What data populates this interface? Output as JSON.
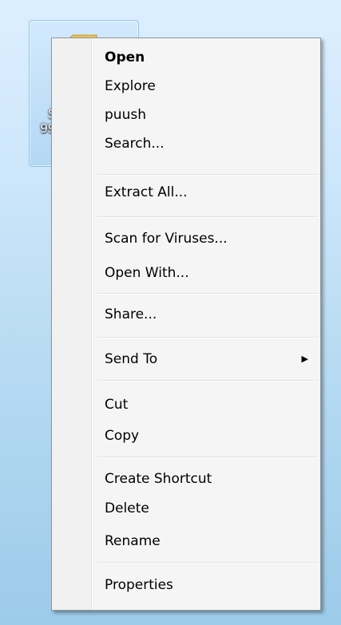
{
  "desktop_icon": {
    "label_lines": [
      "Se",
      "990",
      "("
    ],
    "icon": "folder-icon"
  },
  "context_menu": {
    "items": [
      {
        "label": "Open",
        "default": true
      },
      {
        "label": "Explore"
      },
      {
        "label": "puush"
      },
      {
        "label": "Search..."
      },
      {
        "label": "Extract All..."
      },
      {
        "label": "Scan for Viruses..."
      },
      {
        "label": "Open With..."
      },
      {
        "label": "Share..."
      },
      {
        "label": "Send To",
        "submenu": true,
        "submenu_icon": "chevron-right-icon",
        "arrow_glyph": "▶"
      },
      {
        "label": "Cut"
      },
      {
        "label": "Copy"
      },
      {
        "label": "Create Shortcut"
      },
      {
        "label": "Delete"
      },
      {
        "label": "Rename"
      },
      {
        "label": "Properties"
      }
    ]
  }
}
